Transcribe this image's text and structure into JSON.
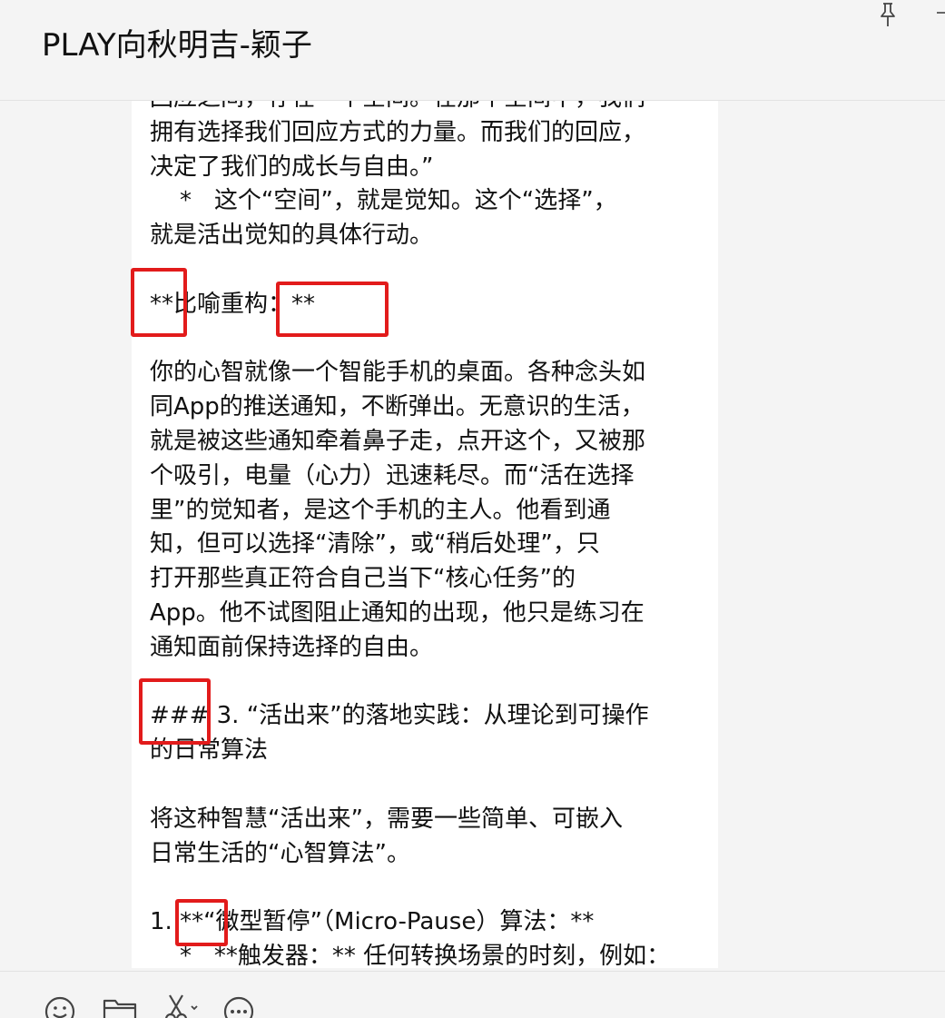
{
  "window": {
    "title": "PLAY向秋明吉-颖子"
  },
  "message": {
    "lines": [
      "回应之间，存在一个空间。在那个空间中，我们",
      "拥有选择我们回应方式的力量。而我们的回应，",
      "决定了我们的成长与自由。”",
      "    *   这个“空间”，就是觉知。这个“选择”，",
      "就是活出觉知的具体行动。",
      "",
      "**比喻重构：**",
      "",
      "你的心智就像一个智能手机的桌面。各种念头如",
      "同App的推送通知，不断弹出。无意识的生活，",
      "就是被这些通知牵着鼻子走，点开这个，又被那",
      "个吸引，电量（心力）迅速耗尽。而“活在选择",
      "里”的觉知者，是这个手机的主人。他看到通",
      "知，但可以选择“清除”，或“稍后处理”，只",
      "打开那些真正符合自己当下“核心任务”的",
      "App。他不试图阻止通知的出现，他只是练习在",
      "通知面前保持选择的自由。",
      "",
      "### 3. “活出来”的落地实践：从理论到可操作",
      "的日常算法",
      "",
      "将这种智慧“活出来”，需要一些简单、可嵌入",
      "日常生活的“心智算法”。",
      "",
      "1. **“微型暂停”（Micro-Pause）算法：**",
      "    *   **触发器：** 任何转换场景的时刻，例如："
    ]
  },
  "toolbar": {
    "items": [
      "emoji-icon",
      "folder-icon",
      "scissors-icon",
      "more-icon"
    ]
  },
  "colors": {
    "highlight": "#e21b1b",
    "bubble": "#ffffff",
    "background": "#f4f4f4"
  }
}
